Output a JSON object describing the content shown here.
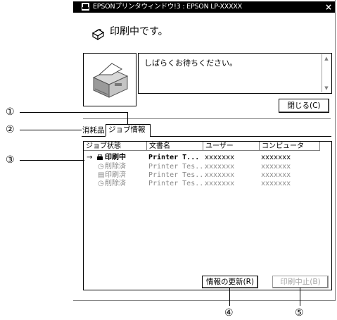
{
  "window": {
    "title": "EPSONプリンタウィンドウ!3 : EPSON LP-XXXXX",
    "close_glyph": "×"
  },
  "status": {
    "message": "印刷中です。",
    "detail": "しばらくお待ちください。"
  },
  "buttons": {
    "close": "閉じる(C)",
    "refresh": "情報の更新(R)",
    "cancel_print": "印刷中止(B)"
  },
  "tabs": [
    "消耗品",
    "ジョブ情報"
  ],
  "callouts": [
    "①",
    "②",
    "③",
    "④",
    "⑤"
  ],
  "job_table": {
    "columns": [
      "ジョブ状態",
      "文書名",
      "ユーザー",
      "コンピュータ"
    ],
    "rows": [
      {
        "status": "印刷中",
        "doc": "Printer T...",
        "user": "xxxxxxx",
        "computer": "xxxxxxx",
        "state": "active"
      },
      {
        "status": "削除済",
        "doc": "Printer Tes...",
        "user": "xxxxxxx",
        "computer": "xxxxxxx",
        "state": "deleted"
      },
      {
        "status": "印刷済",
        "doc": "Printer Tes...",
        "user": "xxxxxxx",
        "computer": "xxxxxxx",
        "state": "printed"
      },
      {
        "status": "削除済",
        "doc": "Printer Tes...",
        "user": "xxxxxxx",
        "computer": "xxxxxxx",
        "state": "deleted"
      }
    ]
  },
  "colors": {
    "titlebar": "#000000",
    "disabled_text": "#a8a8a8"
  }
}
